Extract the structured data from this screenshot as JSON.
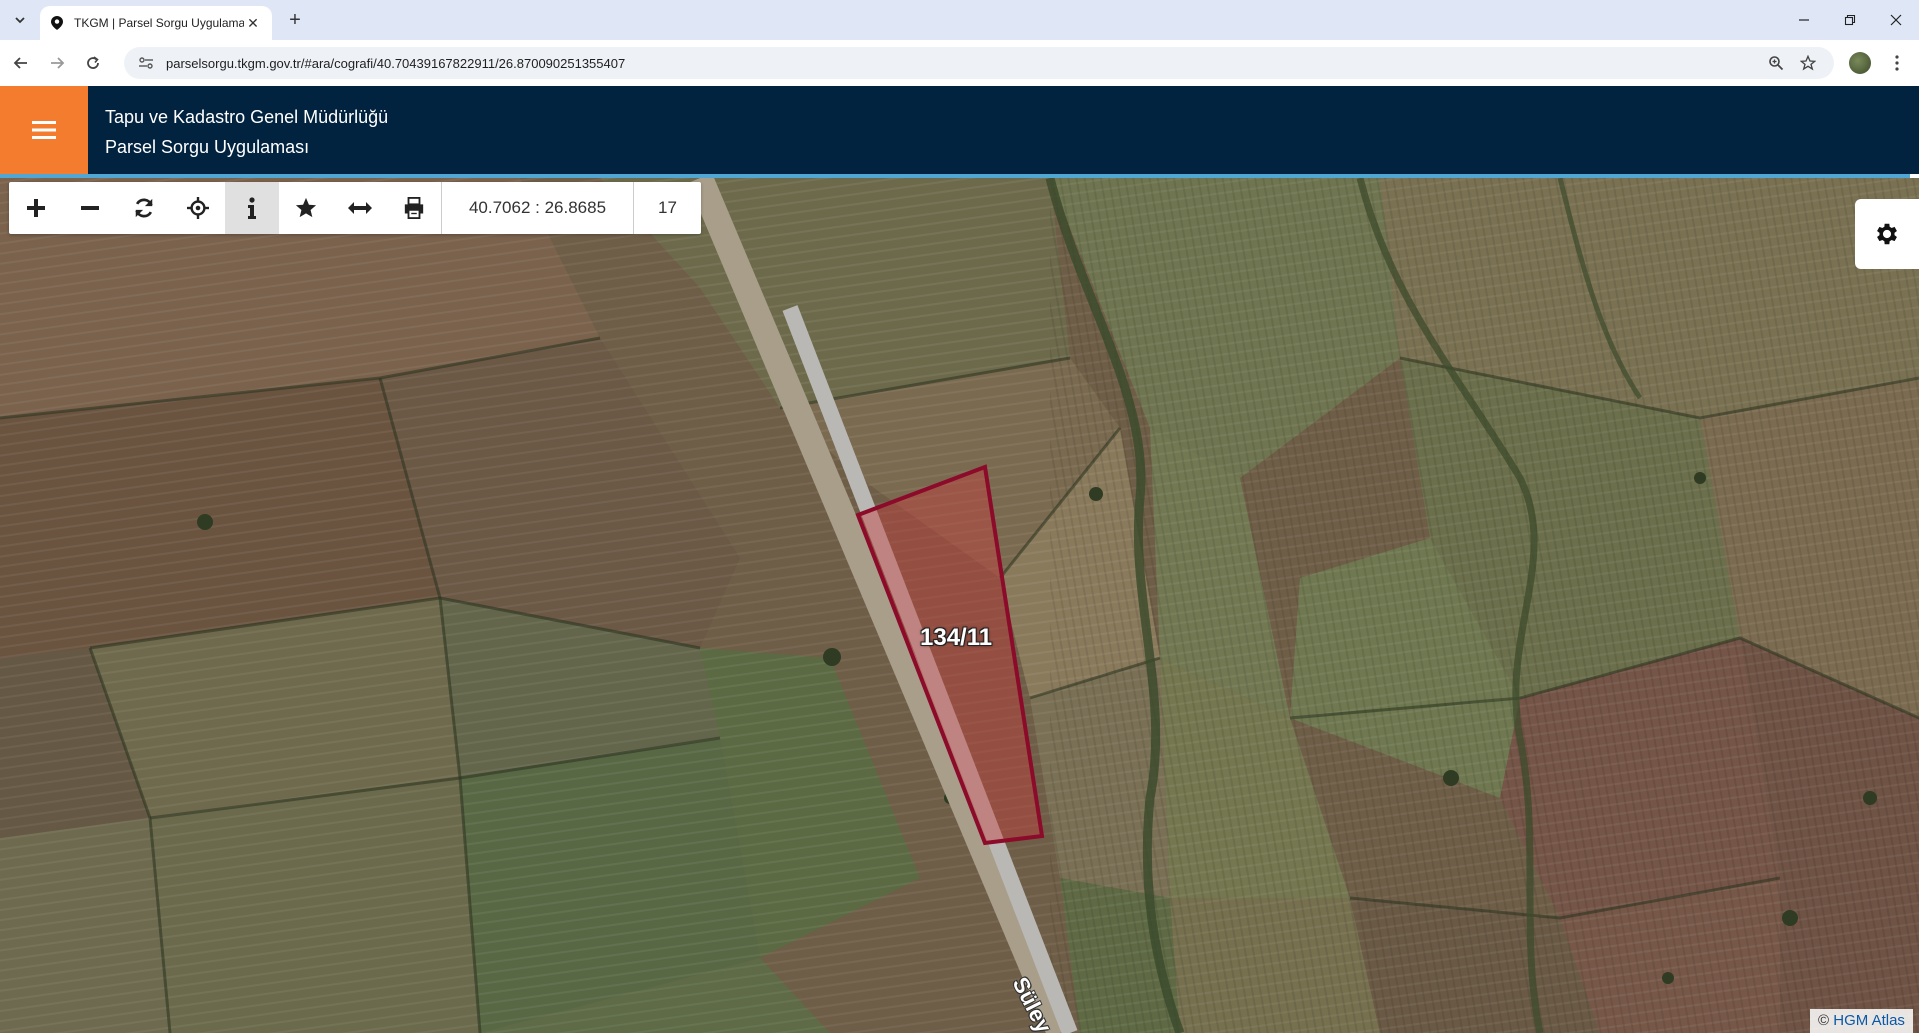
{
  "browser": {
    "tab_title": "TKGM | Parsel Sorgu Uygulaması",
    "new_tab_icon": "+",
    "close_icon": "✕",
    "url": "parselsorgu.tkgm.gov.tr/#ara/cografi/40.70439167822911/26.870090251355407"
  },
  "app": {
    "org_name": "Tapu ve Kadastro Genel Müdürlüğü",
    "app_name": "Parsel Sorgu Uygulaması",
    "colors": {
      "header_bg": "#022340",
      "menu_bg": "#f47c2e",
      "accent": "#50a7d4",
      "parcel_stroke": "#8c0a2a"
    }
  },
  "toolbar": {
    "buttons": [
      "zoom-in",
      "zoom-out",
      "refresh",
      "locate",
      "info",
      "favorite",
      "measure",
      "print"
    ],
    "active": "info",
    "coordinates": "40.7062 : 26.8685",
    "zoom_level": "17"
  },
  "map": {
    "parcel_label": "134/11",
    "road_label": "Süley",
    "attribution_symbol": "©",
    "attribution_link": "HGM Atlas"
  }
}
